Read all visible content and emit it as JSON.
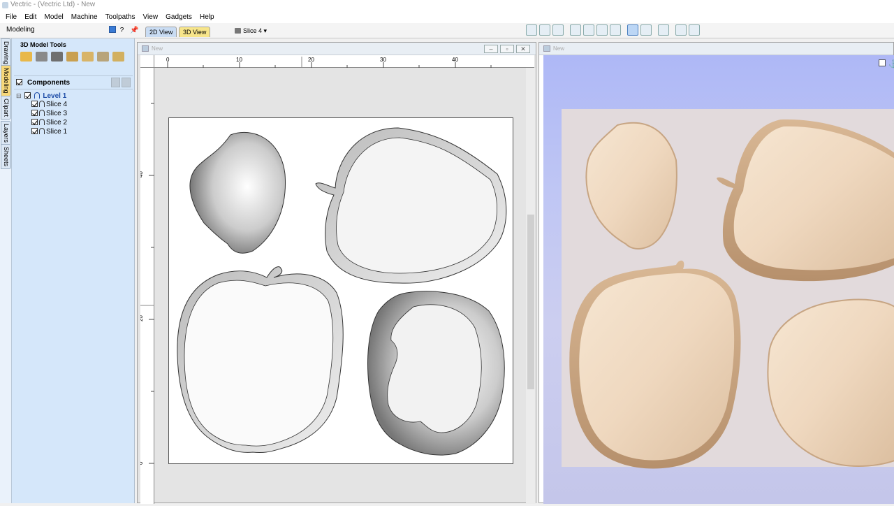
{
  "window": {
    "title": "Vectric - (Vectric Ltd) - New"
  },
  "menu": [
    "File",
    "Edit",
    "Model",
    "Machine",
    "Toolpaths",
    "View",
    "Gadgets",
    "Help"
  ],
  "toolbar": {
    "panel_title": "Modeling",
    "panel_help": "?",
    "tab_2d": "2D View",
    "tab_3d": "3D View",
    "slice_selector": "Slice 4 ▾"
  },
  "side_tabs": [
    "Drawing",
    "Modeling",
    "Clipart",
    "Layers",
    "Sheets"
  ],
  "left_panel": {
    "heading": "3D Model Tools",
    "components_label": "Components",
    "level": "Level 1",
    "slices": [
      "Slice 4",
      "Slice 3",
      "Slice 2",
      "Slice 1"
    ]
  },
  "view_2d": {
    "title": "New",
    "ruler_h": [
      "0",
      "10",
      "20",
      "30",
      "40"
    ],
    "ruler_v": [
      "40",
      "20",
      "0"
    ]
  },
  "view_3d": {
    "title": "New"
  },
  "colors": {
    "accent": "#c9dcf3",
    "active_tab": "#f7d87a",
    "wood": "#f0dcc4",
    "panel": "#d5e7fa"
  }
}
